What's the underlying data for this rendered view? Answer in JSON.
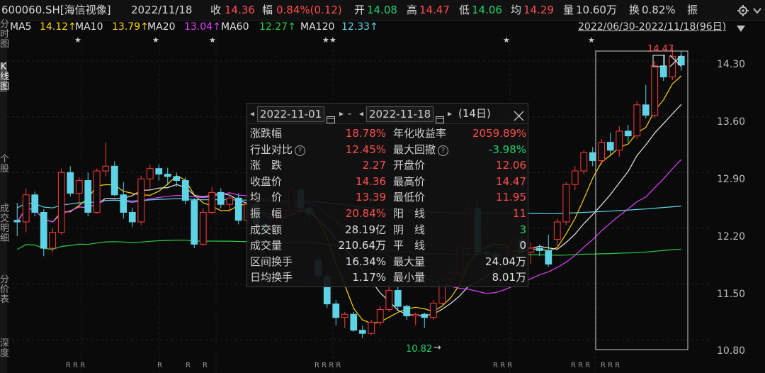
{
  "header": {
    "code": "600060.SH[海信视像]",
    "date": "2022/11/18",
    "close_label": "收",
    "close": "14.36",
    "change_label": "幅",
    "change": "0.84%(0.12)",
    "open_label": "开",
    "open": "14.08",
    "high_label": "高",
    "high": "14.47",
    "low_label": "低",
    "low": "14.06",
    "avg_label": "均",
    "avg": "14.29",
    "vol_label": "量",
    "vol": "10.60万",
    "turnover_label": "换",
    "turnover": "0.82%",
    "amp_label": "振"
  },
  "ma": [
    {
      "label": "MA5",
      "value": "14.12↑",
      "color": "#e0e0e0",
      "vcolor": "#ffd400"
    },
    {
      "label": "MA10",
      "value": "13.79↑",
      "color": "#e0e0e0",
      "vcolor": "#ffd400"
    },
    {
      "label": "MA20",
      "value": "13.04↑",
      "color": "#e0e0e0",
      "vcolor": "#e040fb"
    },
    {
      "label": "MA60",
      "value": "12.27↑",
      "color": "#e0e0e0",
      "vcolor": "#2ecc40"
    },
    {
      "label": "MA120",
      "value": "12.33↑",
      "color": "#e0e0e0",
      "vcolor": "#5fd3e6"
    }
  ],
  "range_label": "2022/06/30-2022/11/18(96日)",
  "left_tabs": [
    "分时图",
    "K线图",
    "个股",
    "成交明细",
    "分价表",
    "深度"
  ],
  "y_axis": [
    "14.30",
    "13.60",
    "12.90",
    "12.20",
    "11.50",
    "10.80"
  ],
  "high_marker": "14.47",
  "low_marker": "10.82",
  "popup": {
    "start_date": "2022-11-01",
    "dash": "-",
    "end_date": "2022-11-18",
    "days": "(14日)",
    "rows": [
      {
        "l1": "涨跌幅",
        "v1": "18.78%",
        "c1": "#ff4d4f",
        "l2": "年化收益率",
        "v2": "2059.89%",
        "c2": "#ff4d4f"
      },
      {
        "l1": "行业对比",
        "q1": true,
        "v1": "12.45%",
        "c1": "#ff4d4f",
        "l2": "最大回撤",
        "q2": true,
        "v2": "-3.98%",
        "c2": "#1fd16a"
      },
      {
        "l1": "涨　跌",
        "v1": "2.27",
        "c1": "#ff4d4f",
        "l2": "开盘价",
        "v2": "12.06",
        "c2": "#ff4d4f"
      },
      {
        "l1": "收盘价",
        "v1": "14.36",
        "c1": "#ff4d4f",
        "l2": "最高价",
        "v2": "14.47",
        "c2": "#ff4d4f"
      },
      {
        "l1": "均　价",
        "v1": "13.39",
        "c1": "#ff4d4f",
        "l2": "最低价",
        "v2": "11.95",
        "c2": "#ff4d4f"
      },
      {
        "l1": "振　幅",
        "v1": "20.84%",
        "c1": "#ff4d4f",
        "l2": "阳　线",
        "v2": "11",
        "c2": "#ff4d4f"
      },
      {
        "l1": "成交额",
        "v1": "28.19亿",
        "c1": "#e0e0e0",
        "l2": "阴　线",
        "v2": "3",
        "c2": "#1fd16a"
      },
      {
        "l1": "成交量",
        "v1": "210.64万",
        "c1": "#e0e0e0",
        "l2": "平　线",
        "v2": "0",
        "c2": "#e0e0e0"
      },
      {
        "l1": "区间换手",
        "v1": "16.34%",
        "c1": "#e0e0e0",
        "l2": "最大量",
        "v2": "24.04万",
        "c2": "#e0e0e0"
      },
      {
        "l1": "日均换手",
        "v1": "1.17%",
        "c1": "#e0e0e0",
        "l2": "最小量",
        "v2": "8.01万",
        "c2": "#e0e0e0"
      }
    ]
  },
  "chart_data": {
    "type": "candlestick",
    "y_range": [
      10.65,
      14.55
    ],
    "y_ticks": [
      14.3,
      13.6,
      12.9,
      12.2,
      11.5,
      10.8
    ],
    "bull_color": "#ff3a3a",
    "bear_color": "#5fd3e6",
    "candles": [
      [
        12.3,
        12.52,
        12.1,
        12.28
      ],
      [
        12.28,
        12.7,
        12.15,
        12.62
      ],
      [
        12.62,
        12.66,
        12.35,
        12.4
      ],
      [
        12.4,
        12.44,
        11.85,
        11.95
      ],
      [
        11.95,
        12.2,
        11.9,
        12.15
      ],
      [
        12.15,
        12.95,
        12.12,
        12.9
      ],
      [
        12.9,
        12.98,
        12.6,
        12.64
      ],
      [
        12.64,
        12.84,
        12.5,
        12.8
      ],
      [
        12.8,
        12.9,
        12.35,
        12.4
      ],
      [
        12.4,
        12.95,
        12.38,
        12.92
      ],
      [
        12.92,
        13.28,
        12.85,
        12.98
      ],
      [
        12.98,
        13.04,
        12.6,
        12.62
      ],
      [
        12.62,
        12.78,
        12.32,
        12.4
      ],
      [
        12.4,
        12.46,
        12.22,
        12.28
      ],
      [
        12.28,
        12.86,
        12.24,
        12.82
      ],
      [
        12.82,
        13.0,
        12.7,
        12.95
      ],
      [
        12.95,
        13.0,
        12.8,
        12.88
      ],
      [
        12.88,
        12.96,
        12.74,
        12.85
      ],
      [
        12.85,
        12.9,
        12.72,
        12.8
      ],
      [
        12.8,
        12.84,
        12.5,
        12.55
      ],
      [
        12.55,
        12.58,
        11.95,
        12.0
      ],
      [
        12.0,
        12.45,
        11.98,
        12.4
      ],
      [
        12.4,
        12.72,
        12.38,
        12.65
      ],
      [
        12.65,
        12.7,
        12.45,
        12.5
      ],
      [
        12.5,
        12.62,
        12.4,
        12.58
      ],
      [
        12.58,
        12.64,
        12.25,
        12.3
      ],
      [
        12.3,
        12.55,
        12.25,
        12.5
      ],
      [
        12.5,
        12.66,
        12.2,
        12.25
      ],
      [
        12.25,
        12.28,
        12.1,
        12.15
      ],
      [
        12.15,
        12.4,
        12.12,
        12.35
      ],
      [
        12.35,
        12.45,
        12.28,
        12.42
      ],
      [
        12.42,
        12.72,
        12.38,
        12.68
      ],
      [
        12.68,
        12.7,
        12.4,
        12.45
      ],
      [
        12.45,
        12.5,
        12.3,
        12.38
      ],
      [
        11.8,
        11.86,
        11.55,
        11.6
      ],
      [
        11.6,
        11.65,
        11.2,
        11.25
      ],
      [
        11.25,
        11.3,
        10.98,
        11.08
      ],
      [
        11.08,
        11.15,
        10.95,
        11.12
      ],
      [
        11.12,
        11.15,
        10.9,
        10.92
      ],
      [
        10.92,
        10.98,
        10.82,
        10.88
      ],
      [
        10.88,
        11.05,
        10.86,
        11.02
      ],
      [
        11.02,
        11.22,
        10.98,
        11.18
      ],
      [
        11.18,
        11.46,
        11.15,
        11.42
      ],
      [
        11.42,
        11.48,
        11.18,
        11.22
      ],
      [
        11.22,
        11.24,
        11.05,
        11.1
      ],
      [
        11.1,
        11.14,
        10.98,
        11.12
      ],
      [
        11.12,
        11.14,
        10.95,
        11.08
      ],
      [
        11.08,
        11.3,
        11.05,
        11.26
      ],
      [
        11.26,
        11.6,
        11.24,
        11.56
      ],
      [
        11.56,
        11.7,
        11.5,
        11.64
      ],
      [
        11.64,
        12.0,
        11.6,
        11.95
      ],
      [
        11.95,
        12.5,
        11.9,
        12.45
      ],
      [
        12.45,
        12.55,
        11.85,
        11.9
      ],
      [
        11.9,
        11.95,
        11.82,
        11.88
      ],
      [
        11.88,
        11.92,
        11.78,
        11.82
      ],
      [
        11.82,
        11.96,
        11.8,
        11.92
      ],
      [
        11.92,
        12.1,
        11.88,
        12.05
      ],
      [
        12.05,
        12.12,
        11.85,
        11.9
      ],
      [
        11.9,
        12.02,
        11.75,
        11.95
      ],
      [
        11.95,
        12.0,
        11.85,
        11.92
      ],
      [
        11.92,
        12.12,
        11.72,
        11.75
      ],
      [
        12.06,
        12.32,
        11.98,
        12.28
      ],
      [
        12.28,
        12.78,
        12.24,
        12.75
      ],
      [
        12.75,
        12.98,
        12.68,
        12.92
      ],
      [
        12.92,
        13.18,
        12.88,
        13.15
      ],
      [
        13.15,
        13.22,
        12.98,
        13.05
      ],
      [
        13.05,
        13.32,
        13.0,
        13.28
      ],
      [
        13.28,
        13.4,
        13.12,
        13.18
      ],
      [
        13.18,
        13.48,
        13.1,
        13.42
      ],
      [
        13.42,
        13.5,
        13.28,
        13.36
      ],
      [
        13.36,
        13.8,
        13.32,
        13.75
      ],
      [
        13.75,
        14.0,
        13.58,
        13.62
      ],
      [
        13.62,
        14.3,
        13.58,
        14.24
      ],
      [
        14.24,
        14.38,
        14.05,
        14.1
      ],
      [
        14.1,
        14.47,
        14.06,
        14.36
      ],
      [
        14.36,
        14.42,
        14.18,
        14.25
      ]
    ]
  }
}
